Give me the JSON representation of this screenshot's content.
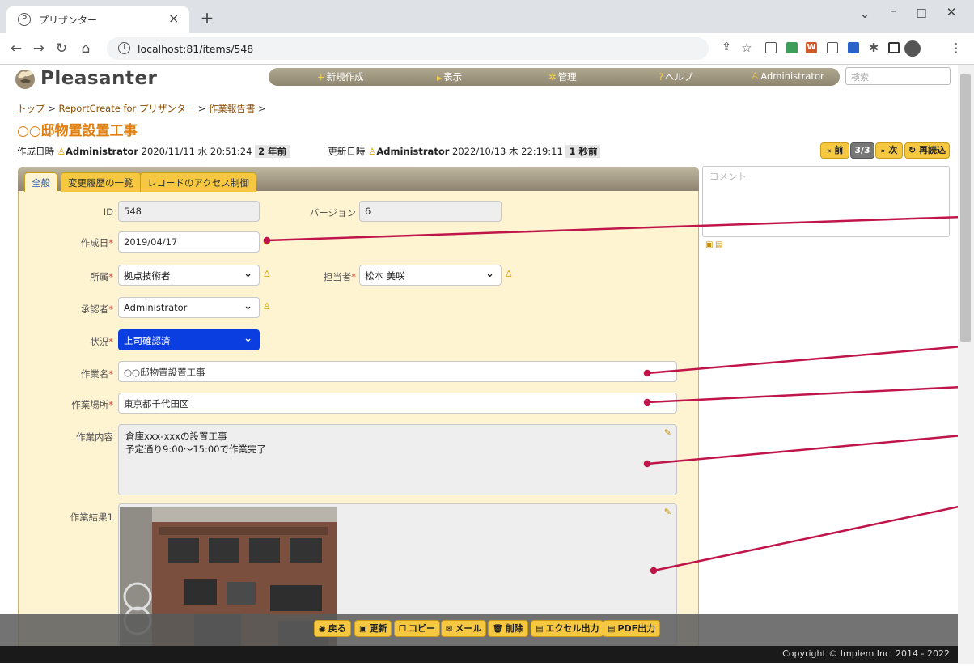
{
  "browser": {
    "tab_title": "プリザンター",
    "tab_close": "×",
    "new_tab": "+",
    "url": "localhost:81/items/548"
  },
  "app": {
    "logo": "Pleasanter",
    "nav": [
      {
        "label": "新規作成"
      },
      {
        "label": "表示"
      },
      {
        "label": "管理"
      },
      {
        "label": "ヘルプ"
      },
      {
        "label": "Administrator"
      }
    ],
    "search_placeholder": "検索"
  },
  "breadcrumb": [
    "トップ",
    "ReportCreate for プリザンター",
    "作業報告書"
  ],
  "page_title": "○○邸物置設置工事",
  "meta": {
    "created_label": "作成日時",
    "created_user": "Administrator",
    "created_at": "2020/11/11 水 20:51:24",
    "created_ago": "2 年前",
    "updated_label": "更新日時",
    "updated_user": "Administrator",
    "updated_at": "2022/10/13 木 22:19:11",
    "updated_ago": "1 秒前"
  },
  "pager": {
    "prev": "前",
    "count": "3/3",
    "next": "次",
    "reload": "再読込"
  },
  "tabs": [
    "全般",
    "変更履歴の一覧",
    "レコードのアクセス制御"
  ],
  "fields": {
    "id": {
      "label": "ID",
      "value": "548"
    },
    "version": {
      "label": "バージョン",
      "value": "6"
    },
    "created_date": {
      "label": "作成日",
      "value": "2019/04/17"
    },
    "dept": {
      "label": "所属",
      "value": "拠点技術者"
    },
    "assignee": {
      "label": "担当者",
      "value": "松本 美咲"
    },
    "approver": {
      "label": "承認者",
      "value": "Administrator"
    },
    "status": {
      "label": "状況",
      "value": "上司確認済"
    },
    "work_name": {
      "label": "作業名",
      "value": "○○邸物置設置工事"
    },
    "work_place": {
      "label": "作業場所",
      "value": "東京都千代田区"
    },
    "work_content": {
      "label": "作業内容",
      "line1": "倉庫xxx-xxxの設置工事",
      "line2": "予定通り9:00〜15:00で作業完了"
    },
    "work_result": {
      "label": "作業結果1"
    }
  },
  "comment_placeholder": "コメント",
  "toolbar": {
    "back": "戻る",
    "update": "更新",
    "copy": "コピー",
    "mail": "メール",
    "delete": "削除",
    "excel": "エクセル出力",
    "pdf": "PDF出力"
  },
  "footer": "Copyright © Implem Inc. 2014 - 2022",
  "colors": {
    "accent": "#f6c842",
    "status_bg": "#0b3ee0",
    "title": "#e07f10",
    "callout": "#c0154a"
  }
}
